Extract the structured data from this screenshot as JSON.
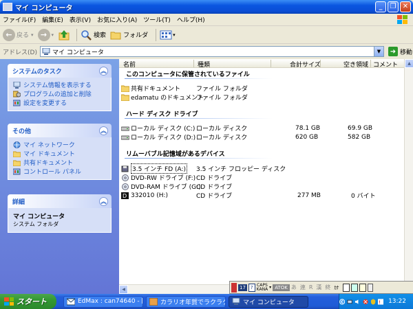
{
  "window": {
    "title": "マイ コンピュータ",
    "controls": {
      "minimize": "_",
      "maximize": "❐",
      "close": "✕"
    }
  },
  "menu": [
    "ファイル(F)",
    "編集(E)",
    "表示(V)",
    "お気に入り(A)",
    "ツール(T)",
    "ヘルプ(H)"
  ],
  "toolbar": {
    "back": "戻る",
    "search": "検索",
    "folders": "フォルダ"
  },
  "address": {
    "label": "アドレス(D)",
    "value": "マイ コンピュータ",
    "go": "移動"
  },
  "sidebar": {
    "system_tasks": {
      "title": "システムのタスク",
      "items": [
        "システム情報を表示する",
        "プログラムの追加と削除",
        "設定を変更する"
      ]
    },
    "other_places": {
      "title": "その他",
      "items": [
        "マイ ネットワーク",
        "マイ ドキュメント",
        "共有ドキュメント",
        "コントロール パネル"
      ]
    },
    "details": {
      "title": "詳細",
      "name": "マイ コンピュータ",
      "type": "システム フォルダ"
    }
  },
  "columns": {
    "name": "名前",
    "type": "種類",
    "total": "合計サイズ",
    "free": "空き領域",
    "comment": "コメント"
  },
  "groups": [
    {
      "title": "このコンピュータに保管されているファイル",
      "items": [
        {
          "name": "共有ドキュメント",
          "type": "ファイル フォルダ",
          "total": "",
          "free": "",
          "icon": "folder-icon"
        },
        {
          "name": "edamatu のドキュメント",
          "type": "ファイル フォルダ",
          "total": "",
          "free": "",
          "icon": "folder-icon"
        }
      ]
    },
    {
      "title": "ハード ディスク ドライブ",
      "items": [
        {
          "name": "ローカル ディスク (C:)",
          "type": "ローカル ディスク",
          "total": "78.1 GB",
          "free": "69.9 GB",
          "icon": "hard-disk-icon"
        },
        {
          "name": "ローカル ディスク (D:)",
          "type": "ローカル ディスク",
          "total": "620 GB",
          "free": "582 GB",
          "icon": "hard-disk-icon"
        }
      ]
    },
    {
      "title": "リムーバブル記憶域があるデバイス",
      "items": [
        {
          "name": "3.5 インチ FD (A:)",
          "type": "3.5 インチ フロッピー ディスク",
          "total": "",
          "free": "",
          "icon": "floppy-icon"
        },
        {
          "name": "DVD-RW ドライブ (F:)",
          "type": "CD ドライブ",
          "total": "",
          "free": "",
          "icon": "cd-drive-icon"
        },
        {
          "name": "DVD-RAM ドライブ (G:)",
          "type": "CD ドライブ",
          "total": "",
          "free": "",
          "icon": "cd-drive-icon"
        },
        {
          "name": "332010 (H:)",
          "type": "CD ドライブ",
          "total": "277 MB",
          "free": "0 バイト",
          "icon": "cd-media-icon"
        }
      ]
    }
  ],
  "ime": {
    "caps": "CAPS",
    "kana": "KANA",
    "atok": "ATOK",
    "modes": [
      "あ",
      "連",
      "R",
      "漢",
      "終"
    ],
    "kana2": "ｶﾅ"
  },
  "taskbar": {
    "start": "スタート",
    "tasks": [
      "EdMax : can74640 - [...",
      "カラリオ年賀でラクラク...",
      "マイ コンピュータ"
    ],
    "clock": "13:22"
  },
  "colors": {
    "accent": "#215dc6",
    "titlebar": "#0a55e0",
    "start": "#339933"
  }
}
